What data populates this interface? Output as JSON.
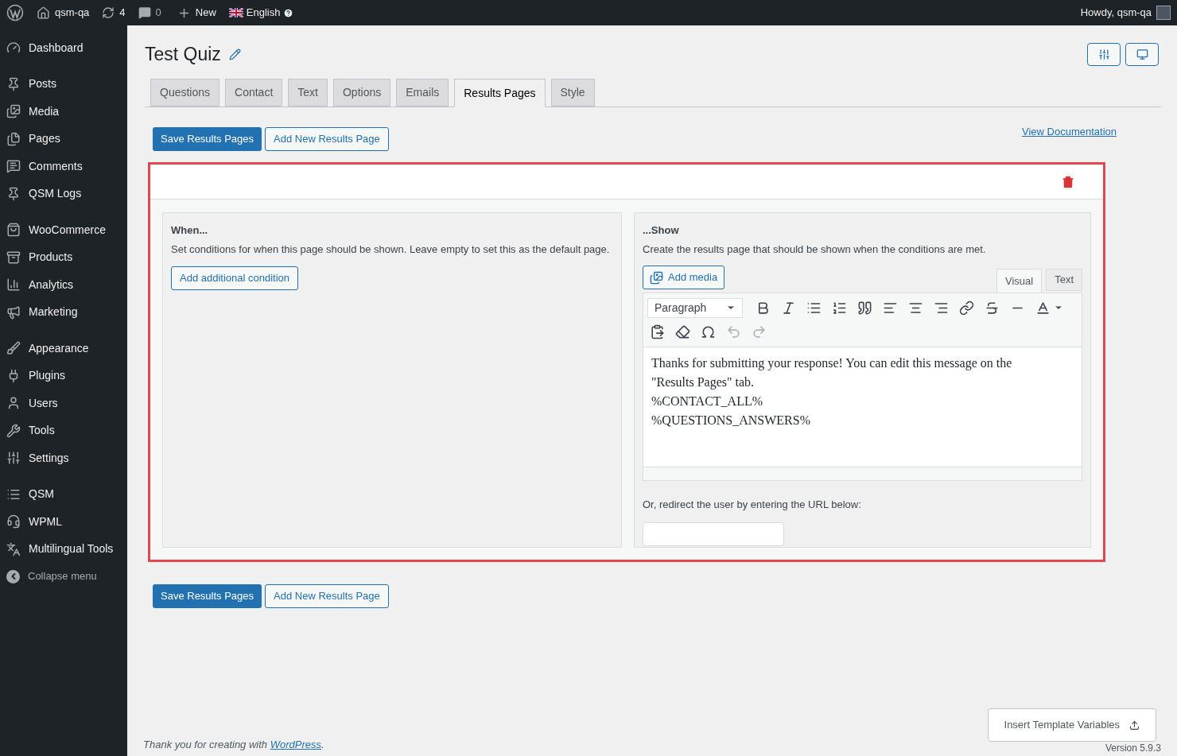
{
  "admin_bar": {
    "site": "qsm-qa",
    "updates": "4",
    "comments": "0",
    "new": "New",
    "language": "English",
    "greeting": "Howdy, qsm-qa"
  },
  "sidebar": {
    "groups": [
      [
        {
          "label": "Dashboard"
        }
      ],
      [
        {
          "label": "Posts"
        },
        {
          "label": "Media"
        },
        {
          "label": "Pages"
        },
        {
          "label": "Comments"
        },
        {
          "label": "QSM Logs"
        }
      ],
      [
        {
          "label": "WooCommerce"
        },
        {
          "label": "Products"
        },
        {
          "label": "Analytics"
        },
        {
          "label": "Marketing"
        }
      ],
      [
        {
          "label": "Appearance"
        },
        {
          "label": "Plugins"
        },
        {
          "label": "Users"
        },
        {
          "label": "Tools"
        },
        {
          "label": "Settings"
        }
      ],
      [
        {
          "label": "QSM"
        },
        {
          "label": "WPML"
        },
        {
          "label": "Multilingual Tools"
        }
      ]
    ],
    "collapse": "Collapse menu"
  },
  "page": {
    "title": "Test Quiz"
  },
  "tabs": [
    {
      "label": "Questions",
      "selected": false
    },
    {
      "label": "Contact",
      "selected": false
    },
    {
      "label": "Text",
      "selected": false
    },
    {
      "label": "Options",
      "selected": false
    },
    {
      "label": "Emails",
      "selected": false
    },
    {
      "label": "Results Pages",
      "selected": true
    },
    {
      "label": "Style",
      "selected": false
    }
  ],
  "actions": {
    "save": "Save Results Pages",
    "add": "Add New Results Page",
    "docs": "View Documentation"
  },
  "results_page": {
    "when": {
      "title": "When...",
      "description": "Set conditions for when this page should be shown. Leave empty to set this as the default page.",
      "button": "Add additional condition"
    },
    "show": {
      "title": "...Show",
      "description": "Create the results page that should be shown when the conditions are met.",
      "add_media": "Add media",
      "editor_tabs": [
        {
          "label": "Visual",
          "selected": true
        },
        {
          "label": "Text",
          "selected": false
        }
      ],
      "format": "Paragraph",
      "undo_disabled": true,
      "redo_disabled": true,
      "content": [
        "Thanks for submitting your response! You can edit this message on the \"Results Pages\" tab.",
        "%CONTACT_ALL%",
        "%QUESTIONS_ANSWERS%"
      ],
      "redirect_label": "Or, redirect the user by entering the URL below:"
    }
  },
  "bottom_actions": {
    "save": "Save Results Pages",
    "add": "Add New Results Page"
  },
  "footer": {
    "thanks_prefix": "Thank you for creating with ",
    "thanks_link": "WordPress",
    "thanks_suffix": ".",
    "version": "Version 5.9.3"
  },
  "template_button": "Insert Template Variables"
}
